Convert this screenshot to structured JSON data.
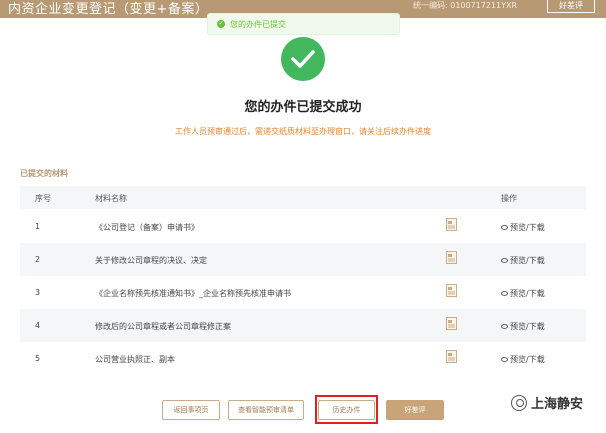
{
  "header": {
    "title": "内资企业变更登记（变更+备案）",
    "code": "统一编码: 0100717211YXR",
    "button_label": "好差评"
  },
  "toast": {
    "text": "您的办件已提交"
  },
  "success": {
    "title": "您的办件已提交成功",
    "notice": "工作人员预审通过后，需递交纸质材料至办理窗口，请关注后续办件进度"
  },
  "section_label": "已提交的材料",
  "table": {
    "headers": [
      "序号",
      "材料名称",
      "操作"
    ],
    "rows": [
      {
        "index": "1",
        "name": "《公司登记（备案）申请书》",
        "action": "预览/下载"
      },
      {
        "index": "2",
        "name": "关于修改公司章程的决议、决定",
        "action": "预览/下载"
      },
      {
        "index": "3",
        "name": "《企业名称预先核准通知书》_企业名称预先核准申请书",
        "action": "预览/下载"
      },
      {
        "index": "4",
        "name": "修改后的公司章程或者公司章程修正案",
        "action": "预览/下载"
      },
      {
        "index": "5",
        "name": "公司营业执照正、副本",
        "action": "预览/下载"
      }
    ]
  },
  "buttons": {
    "back": "返回事项页",
    "view_result": "查看智能预审清单",
    "history": "历史办件",
    "rate": "好差评"
  },
  "watermark": {
    "text": "上海静安"
  },
  "colors": {
    "brand": "#b79a73",
    "success": "#43b75e",
    "notice": "#e8842a",
    "highlight": "#e02020"
  }
}
